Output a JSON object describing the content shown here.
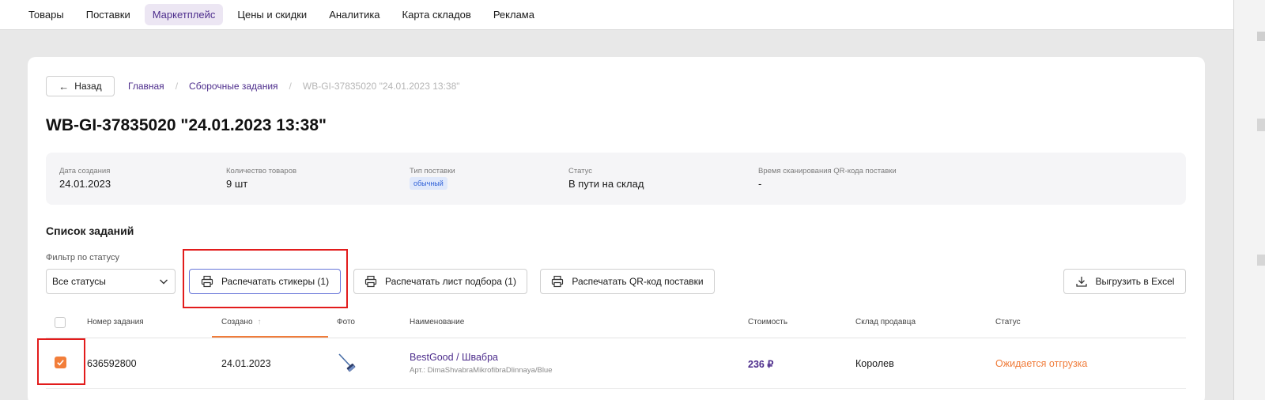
{
  "nav": {
    "items": [
      "Товары",
      "Поставки",
      "Маркетплейс",
      "Цены и скидки",
      "Аналитика",
      "Карта складов",
      "Реклама"
    ],
    "active_index": 2
  },
  "back_label": "Назад",
  "breadcrumb": [
    "Главная",
    "Сборочные задания",
    "WB-GI-37835020 \"24.01.2023 13:38\""
  ],
  "title": "WB-GI-37835020 \"24.01.2023 13:38\"",
  "info": {
    "created_label": "Дата создания",
    "created_value": "24.01.2023",
    "qty_label": "Количество товаров",
    "qty_value": "9 шт",
    "type_label": "Тип поставки",
    "type_value": "обычный",
    "status_label": "Статус",
    "status_value": "В пути на склад",
    "scan_label": "Время сканирования QR-кода поставки",
    "scan_value": "-"
  },
  "tasks_title": "Список заданий",
  "filter": {
    "label": "Фильтр по статусу",
    "value": "Все статусы"
  },
  "actions": {
    "print_stickers": "Распечатать стикеры (1)",
    "print_pick": "Распечатать лист подбора (1)",
    "print_qr": "Распечатать QR-код поставки",
    "export": "Выгрузить в Excel"
  },
  "table": {
    "headers": {
      "number": "Номер задания",
      "created": "Создано",
      "photo": "Фото",
      "name": "Наименование",
      "cost": "Стоимость",
      "warehouse": "Склад продавца",
      "status": "Статус"
    },
    "rows": [
      {
        "checked": true,
        "number": "636592800",
        "created": "24.01.2023",
        "name": "BestGood / Швабра",
        "article": "Арт.: DimaShvabraMikrofibraDlinnaya/Blue",
        "cost": "236 ₽",
        "warehouse": "Королев",
        "status": "Ожидается отгрузка"
      }
    ]
  },
  "colors": {
    "accent_purple": "#4d2d8c",
    "accent_orange": "#f07c3a",
    "highlight_red": "#e21c1c",
    "badge_blue": "#2e5fd6"
  }
}
